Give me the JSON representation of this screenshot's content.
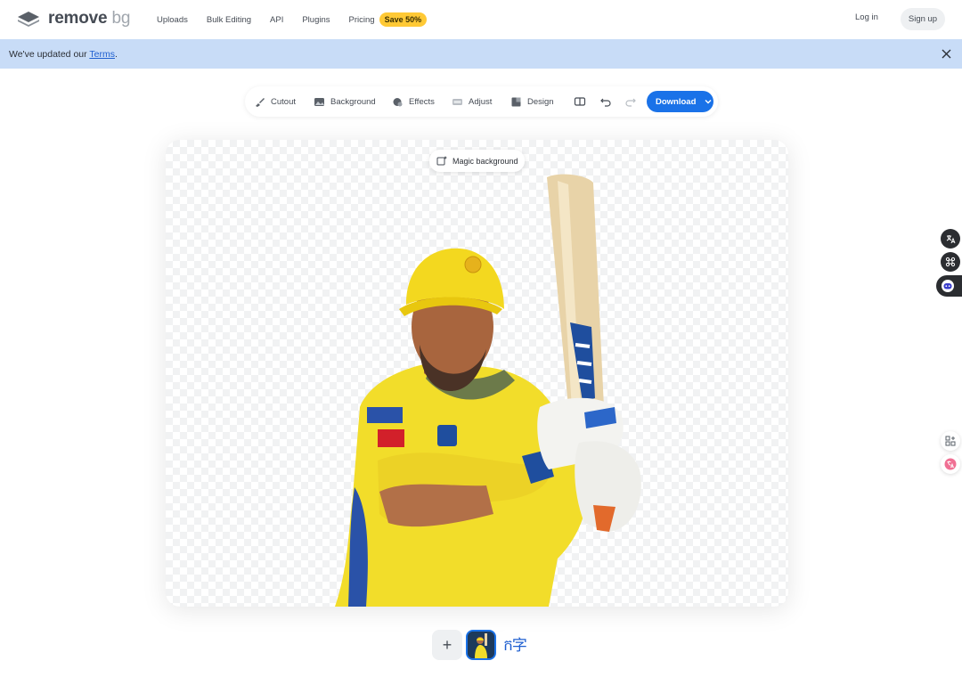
{
  "header": {
    "logo_main": "remove",
    "logo_accent": "bg",
    "nav": [
      "Uploads",
      "Bulk Editing",
      "API",
      "Plugins",
      "Pricing"
    ],
    "promo_badge": "Save 50%",
    "login_label": "Log in",
    "signup_label": "Sign up"
  },
  "banner": {
    "message": "We've updated our ",
    "link": "Terms",
    "suffix": "."
  },
  "toolbar": {
    "cutout": "Cutout",
    "background": "Background",
    "effects": "Effects",
    "adjust": "Adjust",
    "design": "Design",
    "download": "Download"
  },
  "canvas": {
    "magic_background": "Magic background"
  },
  "thumbs": {
    "add_symbol": "+",
    "second_thumb_text": "ក字"
  },
  "colors": {
    "accent": "#1a72e8",
    "banner": "#c8dcf7",
    "badge": "#ffc935"
  }
}
